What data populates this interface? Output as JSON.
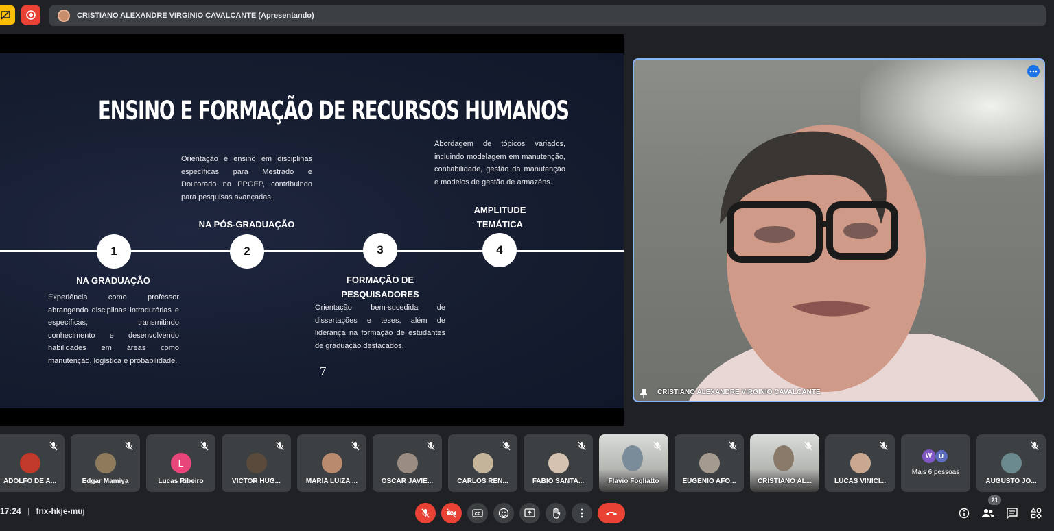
{
  "presenter_bar": {
    "title": "CRISTIANO ALEXANDRE VIRGINIO CAVALCANTE (Apresentando)"
  },
  "slide": {
    "title": "ENSINO E FORMAÇÃO DE RECURSOS HUMANOS",
    "steps": [
      {
        "number": "1",
        "heading": "NA GRADUAÇÃO",
        "text": "Experiência como professor abrangendo disciplinas introdutórias e específicas, transmitindo conhecimento e desenvolvendo habilidades em áreas como manutenção, logística e probabilidade."
      },
      {
        "number": "2",
        "heading": "NA PÓS-GRADUAÇÃO",
        "text": "Orientação e ensino em disciplinas específicas para Mestrado e Doutorado no PPGEP, contribuindo para pesquisas avançadas."
      },
      {
        "number": "3",
        "heading_line1": "FORMAÇÃO DE",
        "heading_line2": "PESQUISADORES",
        "text": "Orientação bem-sucedida de dissertações e teses, além de liderança na formação de estudantes de graduação destacados."
      },
      {
        "number": "4",
        "heading_line1": "AMPLITUDE",
        "heading_line2": "TEMÁTICA",
        "text": "Abordagem de tópicos variados, incluindo modelagem em manutenção, confiabilidade, gestão da manutenção e modelos de gestão de armazéns."
      }
    ],
    "page_number": "7"
  },
  "speaker": {
    "name": "CRISTIANO ALEXANDRE VIRGINIO CAVALCANTE"
  },
  "participants": [
    {
      "name": "ADOLFO DE A...",
      "avatar_color": "#c0392b"
    },
    {
      "name": "Edgar Mamiya",
      "avatar_color": "#8e7b5c"
    },
    {
      "name": "Lucas Ribeiro",
      "avatar_color": "#e8457a",
      "initial": "L"
    },
    {
      "name": "VICTOR HUG...",
      "avatar_color": "#5a4a3c"
    },
    {
      "name": "MARIA LUIZA ...",
      "avatar_color": "#b98a6e"
    },
    {
      "name": "OSCAR JAVIE...",
      "avatar_color": "#9a8c80"
    },
    {
      "name": "CARLOS REN...",
      "avatar_color": "#c4b49a"
    },
    {
      "name": "FABIO SANTA...",
      "avatar_color": "#d6c2b0"
    },
    {
      "name": "Flavio Fogliatto",
      "avatar_color": "#7a8b99"
    },
    {
      "name": "EUGENIO AFO...",
      "avatar_color": "#a59a8e"
    },
    {
      "name": "CRISTIANO AL...",
      "avatar_color": "#8a7a6a"
    },
    {
      "name": "LUCAS VINICI...",
      "avatar_color": "#c9a88f"
    },
    {
      "name": "Mais 6 pessoas",
      "initial_a": "W",
      "initial_b": "U"
    },
    {
      "name": "AUGUSTO JO...",
      "avatar_color": "#6b8a8e"
    }
  ],
  "meeting": {
    "time": "17:24",
    "separator": "|",
    "code": "fnx-hkje-muj",
    "participant_count": "21"
  },
  "colors": {
    "background": "#202124",
    "tile": "#3c4043",
    "danger": "#ea4335",
    "accent": "#8ab4f8"
  }
}
